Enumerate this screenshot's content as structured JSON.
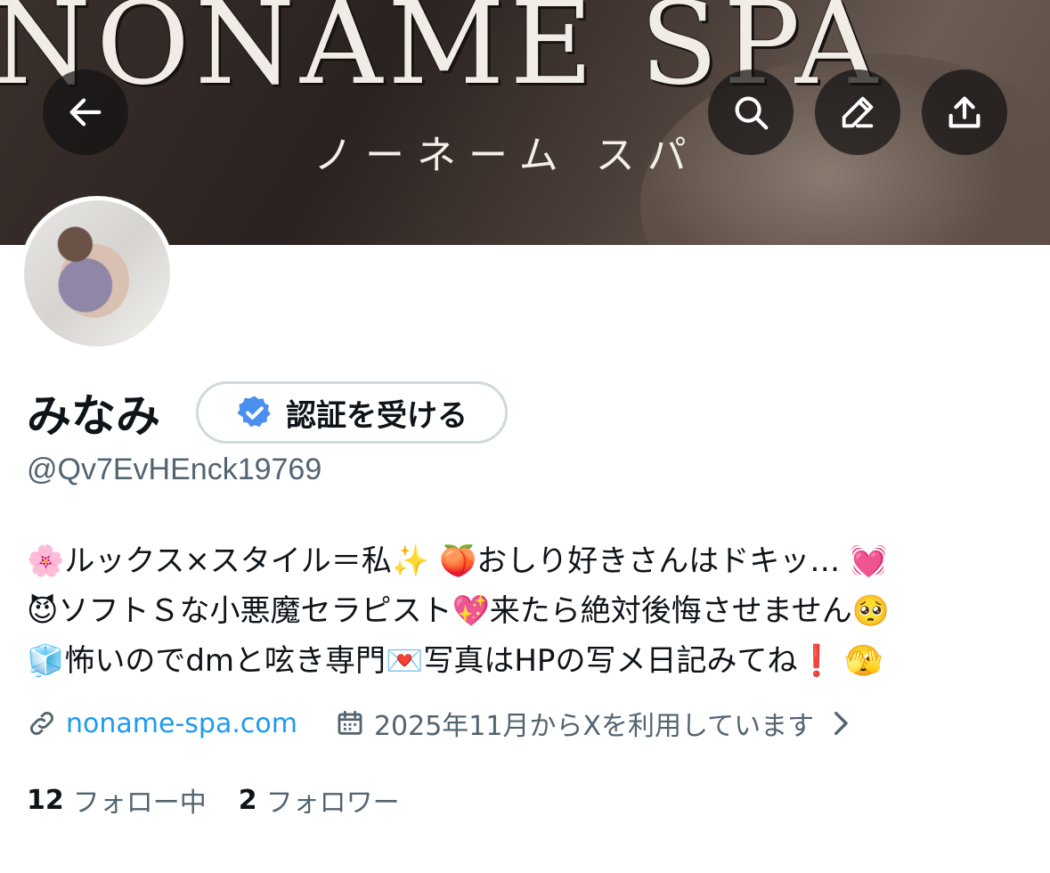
{
  "header": {
    "banner_title": "NONAME SPA",
    "banner_subtitle": "ノーネーム スパ",
    "buttons": {
      "back": "back-arrow-icon",
      "search": "search-icon",
      "edit": "pencil-icon",
      "share": "share-icon"
    }
  },
  "profile": {
    "display_name": "みなみ",
    "verify_label": "認証を受ける",
    "handle": "@Qv7EvHEnck19769",
    "bio_lines": [
      "🌸ルックス×スタイル＝私✨ 🍑おしり好きさんはドキッ… 💓",
      "😈ソフトＳな小悪魔セラピスト💖来たら絶対後悔させません🥺",
      "🧊怖いのでdmと呟き専門💌写真はHPの写メ日記みてね❗️ 🫣"
    ],
    "website": "noname-spa.com",
    "joined": "2025年11月からXを利用しています",
    "following_count": "12",
    "following_label": "フォロー中",
    "followers_count": "2",
    "followers_label": "フォロワー"
  },
  "colors": {
    "accent": "#1d9bf0",
    "secondary_text": "#536471",
    "primary_text": "#0f1419",
    "button_border": "#cfd9de"
  }
}
